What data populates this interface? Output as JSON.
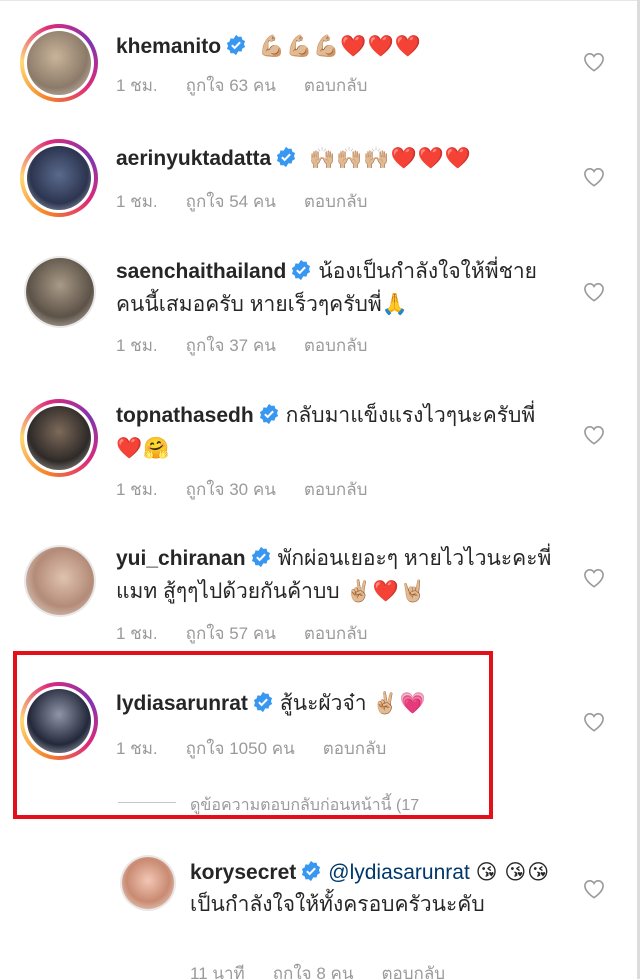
{
  "comments": [
    {
      "username": "khemanito",
      "text": "",
      "emojis": "💪🏼💪🏼💪🏼❤️❤️❤️",
      "time": "1 ชม.",
      "likes": "ถูกใจ 63 คน",
      "reply": "ตอบกลับ"
    },
    {
      "username": "aerinyuktadatta",
      "text": "",
      "emojis": "🙌🏼🙌🏼🙌🏼❤️❤️❤️",
      "time": "1 ชม.",
      "likes": "ถูกใจ 54 คน",
      "reply": "ตอบกลับ"
    },
    {
      "username": "saenchaithailand",
      "text": "น้องเป็นกำลังใจให้พี่ชายคนนี้เสมอครับ หายเร็วๆครับพี่",
      "emojis": "🙏",
      "time": "1 ชม.",
      "likes": "ถูกใจ 37 คน",
      "reply": "ตอบกลับ"
    },
    {
      "username": "topnathasedh",
      "text": "กลับมาแข็งแรงไวๆนะครับพี่",
      "emojis": "❤️🤗",
      "time": "1 ชม.",
      "likes": "ถูกใจ 30 คน",
      "reply": "ตอบกลับ"
    },
    {
      "username": "yui_chiranan",
      "text": "พักผ่อนเยอะๆ หายไวไวนะคะพี่แมท สู้ๆๆไปด้วยกันค้าบบ",
      "emojis": "✌🏼❤️🤘🏼",
      "time": "1 ชม.",
      "likes": "ถูกใจ 57 คน",
      "reply": "ตอบกลับ"
    },
    {
      "username": "lydiasarunrat",
      "text": "สู้นะผัวจ๋า",
      "emojis": "✌🏼💗",
      "time": "1 ชม.",
      "likes": "ถูกใจ 1050 คน",
      "reply": "ตอบกลับ"
    }
  ],
  "view_replies": "ดูข้อความตอบกลับก่อนหน้านี้ (17",
  "reply_comment": {
    "username": "korysecret",
    "mention": "@lydiasarunrat",
    "emojis_1": "😘",
    "emojis_2": "😘😘",
    "text": "เป็นกำลังใจให้ทั้งครอบครัวนะคับ",
    "time": "11 นาที",
    "likes": "ถูกใจ 8 คน",
    "reply": "ตอบกลับ"
  },
  "colors": {
    "highlight": "#e3101a",
    "verified": "#3897f0",
    "meta": "#9a9a9a",
    "mention": "#00376b"
  },
  "icons": {
    "like": "heart-outline-icon",
    "verified": "verified-badge-icon"
  }
}
